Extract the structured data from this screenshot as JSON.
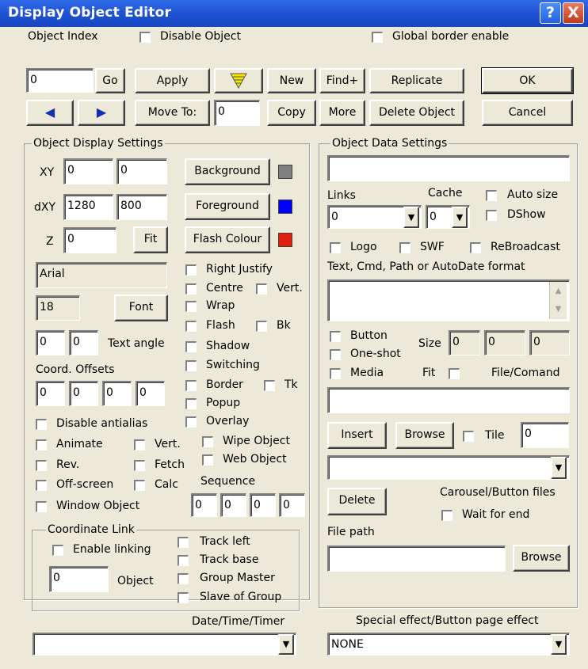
{
  "window": {
    "title": "Display Object Editor",
    "help_glyph": "?",
    "close_glyph": "X"
  },
  "top": {
    "object_index_label": "Object Index",
    "object_index_value": "0",
    "disable_object_label": "Disable Object",
    "global_border_label": "Global border enable",
    "go": "Go",
    "apply": "Apply",
    "new": "New",
    "find_plus": "Find+",
    "replicate": "Replicate",
    "ok": "OK",
    "move_to": "Move To:",
    "move_to_value": "0",
    "copy": "Copy",
    "more": "More",
    "delete_object": "Delete Object",
    "cancel": "Cancel",
    "prev_glyph": "◀",
    "next_glyph": "▶"
  },
  "display": {
    "group_title": "Object Display Settings",
    "xy_label": "XY",
    "x": "0",
    "y": "0",
    "dxy_label": "dXY",
    "dx": "1280",
    "dy": "800",
    "z_label": "Z",
    "z": "0",
    "fit": "Fit",
    "background": "Background",
    "foreground": "Foreground",
    "flash_colour": "Flash Colour",
    "font_name": "Arial",
    "font_size": "18",
    "font_button": "Font",
    "angle_a": "0",
    "angle_b": "0",
    "text_angle_label": "Text angle",
    "coord_offsets_label": "Coord. Offsets",
    "offsets": [
      "0",
      "0",
      "0",
      "0"
    ],
    "checks_right": {
      "right_justify": "Right Justify",
      "centre": "Centre",
      "vert": "Vert.",
      "wrap": "Wrap",
      "flash": "Flash",
      "bk": "Bk",
      "shadow": "Shadow",
      "switching": "Switching",
      "border": "Border",
      "tk": "Tk",
      "popup": "Popup",
      "overlay": "Overlay",
      "wipe_object": "Wipe Object",
      "web_object": "Web Object"
    },
    "checks_left": {
      "disable_antialias": "Disable antialias",
      "animate": "Animate",
      "vert": "Vert.",
      "rev": "Rev.",
      "fetch": "Fetch",
      "off_screen": "Off-screen",
      "calc": "Calc",
      "window_object": "Window Object"
    },
    "sequence_label": "Sequence",
    "sequence": [
      "0",
      "0",
      "0",
      "0"
    ],
    "coord_link": {
      "title": "Coordinate Link",
      "enable_linking": "Enable linking",
      "object_value": "0",
      "object_label": "Object",
      "track_left": "Track left",
      "track_base": "Track base",
      "group_master": "Group Master",
      "slave_of_group": "Slave of Group"
    },
    "date_time_label": "Date/Time/Timer",
    "date_time_value": ""
  },
  "data": {
    "group_title": "Object Data Settings",
    "name_value": "",
    "links_label": "Links",
    "links_value": "0",
    "cache_label": "Cache",
    "cache_value": "0",
    "auto_size": "Auto size",
    "dshow": "DShow",
    "logo": "Logo",
    "swf": "SWF",
    "rebroadcast": "ReBroadcast",
    "text_cmd_label": "Text, Cmd, Path or AutoDate format",
    "text_cmd_value": "",
    "button": "Button",
    "one_shot": "One-shot",
    "media": "Media",
    "size_label": "Size",
    "sizes": [
      "0",
      "0",
      "0"
    ],
    "fit": "Fit",
    "file_command": "File/Comand",
    "file_command_value": "",
    "insert": "Insert",
    "browse": "Browse",
    "tile": "Tile",
    "tile_value": "0",
    "list_value": "",
    "delete": "Delete",
    "carousel_label": "Carousel/Button files",
    "wait_for_end": "Wait for end",
    "file_path_label": "File path",
    "file_path_value": "",
    "browse2": "Browse",
    "special_effect_label": "Special effect/Button page effect",
    "special_effect_value": "NONE"
  },
  "colors": {
    "titlebar": "#1e50d2",
    "background_swatch": "#808080",
    "foreground_swatch": "#0000ff",
    "flash_swatch": "#e02010",
    "filter_icon": "#f3e600"
  }
}
